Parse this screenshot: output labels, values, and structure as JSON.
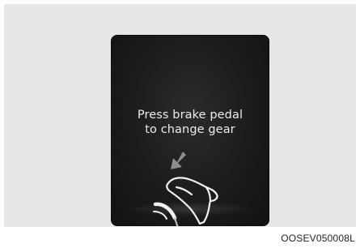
{
  "display": {
    "message_line1": "Press brake pedal",
    "message_line2": "to change gear",
    "illustration_icons": [
      "arrow-down-left-icon",
      "brake-pedal-icon",
      "foot-icon"
    ]
  },
  "figure": {
    "code": "OOSEV050008L"
  },
  "colors": {
    "panel_background": "#e7e7e7",
    "display_background": "#1a1a1a",
    "display_text": "#ececec",
    "arrow": "#8c8c8c"
  }
}
